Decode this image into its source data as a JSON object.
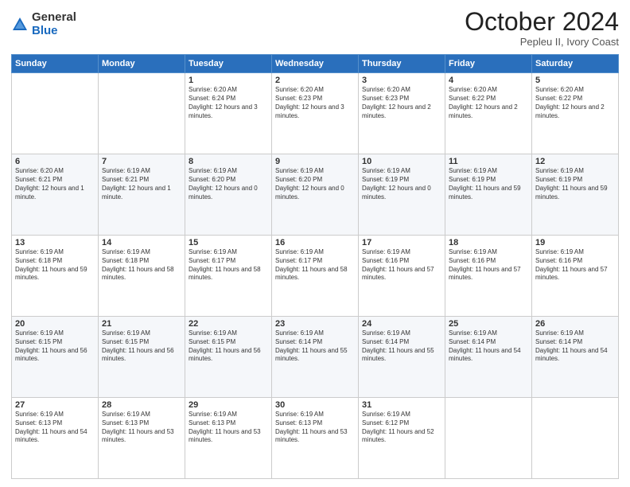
{
  "header": {
    "logo_general": "General",
    "logo_blue": "Blue",
    "month_title": "October 2024",
    "location": "Pepleu II, Ivory Coast"
  },
  "days_of_week": [
    "Sunday",
    "Monday",
    "Tuesday",
    "Wednesday",
    "Thursday",
    "Friday",
    "Saturday"
  ],
  "weeks": [
    [
      {
        "day": "",
        "sunrise": "",
        "sunset": "",
        "daylight": ""
      },
      {
        "day": "",
        "sunrise": "",
        "sunset": "",
        "daylight": ""
      },
      {
        "day": "1",
        "sunrise": "Sunrise: 6:20 AM",
        "sunset": "Sunset: 6:24 PM",
        "daylight": "Daylight: 12 hours and 3 minutes."
      },
      {
        "day": "2",
        "sunrise": "Sunrise: 6:20 AM",
        "sunset": "Sunset: 6:23 PM",
        "daylight": "Daylight: 12 hours and 3 minutes."
      },
      {
        "day": "3",
        "sunrise": "Sunrise: 6:20 AM",
        "sunset": "Sunset: 6:23 PM",
        "daylight": "Daylight: 12 hours and 2 minutes."
      },
      {
        "day": "4",
        "sunrise": "Sunrise: 6:20 AM",
        "sunset": "Sunset: 6:22 PM",
        "daylight": "Daylight: 12 hours and 2 minutes."
      },
      {
        "day": "5",
        "sunrise": "Sunrise: 6:20 AM",
        "sunset": "Sunset: 6:22 PM",
        "daylight": "Daylight: 12 hours and 2 minutes."
      }
    ],
    [
      {
        "day": "6",
        "sunrise": "Sunrise: 6:20 AM",
        "sunset": "Sunset: 6:21 PM",
        "daylight": "Daylight: 12 hours and 1 minute."
      },
      {
        "day": "7",
        "sunrise": "Sunrise: 6:19 AM",
        "sunset": "Sunset: 6:21 PM",
        "daylight": "Daylight: 12 hours and 1 minute."
      },
      {
        "day": "8",
        "sunrise": "Sunrise: 6:19 AM",
        "sunset": "Sunset: 6:20 PM",
        "daylight": "Daylight: 12 hours and 0 minutes."
      },
      {
        "day": "9",
        "sunrise": "Sunrise: 6:19 AM",
        "sunset": "Sunset: 6:20 PM",
        "daylight": "Daylight: 12 hours and 0 minutes."
      },
      {
        "day": "10",
        "sunrise": "Sunrise: 6:19 AM",
        "sunset": "Sunset: 6:19 PM",
        "daylight": "Daylight: 12 hours and 0 minutes."
      },
      {
        "day": "11",
        "sunrise": "Sunrise: 6:19 AM",
        "sunset": "Sunset: 6:19 PM",
        "daylight": "Daylight: 11 hours and 59 minutes."
      },
      {
        "day": "12",
        "sunrise": "Sunrise: 6:19 AM",
        "sunset": "Sunset: 6:19 PM",
        "daylight": "Daylight: 11 hours and 59 minutes."
      }
    ],
    [
      {
        "day": "13",
        "sunrise": "Sunrise: 6:19 AM",
        "sunset": "Sunset: 6:18 PM",
        "daylight": "Daylight: 11 hours and 59 minutes."
      },
      {
        "day": "14",
        "sunrise": "Sunrise: 6:19 AM",
        "sunset": "Sunset: 6:18 PM",
        "daylight": "Daylight: 11 hours and 58 minutes."
      },
      {
        "day": "15",
        "sunrise": "Sunrise: 6:19 AM",
        "sunset": "Sunset: 6:17 PM",
        "daylight": "Daylight: 11 hours and 58 minutes."
      },
      {
        "day": "16",
        "sunrise": "Sunrise: 6:19 AM",
        "sunset": "Sunset: 6:17 PM",
        "daylight": "Daylight: 11 hours and 58 minutes."
      },
      {
        "day": "17",
        "sunrise": "Sunrise: 6:19 AM",
        "sunset": "Sunset: 6:16 PM",
        "daylight": "Daylight: 11 hours and 57 minutes."
      },
      {
        "day": "18",
        "sunrise": "Sunrise: 6:19 AM",
        "sunset": "Sunset: 6:16 PM",
        "daylight": "Daylight: 11 hours and 57 minutes."
      },
      {
        "day": "19",
        "sunrise": "Sunrise: 6:19 AM",
        "sunset": "Sunset: 6:16 PM",
        "daylight": "Daylight: 11 hours and 57 minutes."
      }
    ],
    [
      {
        "day": "20",
        "sunrise": "Sunrise: 6:19 AM",
        "sunset": "Sunset: 6:15 PM",
        "daylight": "Daylight: 11 hours and 56 minutes."
      },
      {
        "day": "21",
        "sunrise": "Sunrise: 6:19 AM",
        "sunset": "Sunset: 6:15 PM",
        "daylight": "Daylight: 11 hours and 56 minutes."
      },
      {
        "day": "22",
        "sunrise": "Sunrise: 6:19 AM",
        "sunset": "Sunset: 6:15 PM",
        "daylight": "Daylight: 11 hours and 56 minutes."
      },
      {
        "day": "23",
        "sunrise": "Sunrise: 6:19 AM",
        "sunset": "Sunset: 6:14 PM",
        "daylight": "Daylight: 11 hours and 55 minutes."
      },
      {
        "day": "24",
        "sunrise": "Sunrise: 6:19 AM",
        "sunset": "Sunset: 6:14 PM",
        "daylight": "Daylight: 11 hours and 55 minutes."
      },
      {
        "day": "25",
        "sunrise": "Sunrise: 6:19 AM",
        "sunset": "Sunset: 6:14 PM",
        "daylight": "Daylight: 11 hours and 54 minutes."
      },
      {
        "day": "26",
        "sunrise": "Sunrise: 6:19 AM",
        "sunset": "Sunset: 6:14 PM",
        "daylight": "Daylight: 11 hours and 54 minutes."
      }
    ],
    [
      {
        "day": "27",
        "sunrise": "Sunrise: 6:19 AM",
        "sunset": "Sunset: 6:13 PM",
        "daylight": "Daylight: 11 hours and 54 minutes."
      },
      {
        "day": "28",
        "sunrise": "Sunrise: 6:19 AM",
        "sunset": "Sunset: 6:13 PM",
        "daylight": "Daylight: 11 hours and 53 minutes."
      },
      {
        "day": "29",
        "sunrise": "Sunrise: 6:19 AM",
        "sunset": "Sunset: 6:13 PM",
        "daylight": "Daylight: 11 hours and 53 minutes."
      },
      {
        "day": "30",
        "sunrise": "Sunrise: 6:19 AM",
        "sunset": "Sunset: 6:13 PM",
        "daylight": "Daylight: 11 hours and 53 minutes."
      },
      {
        "day": "31",
        "sunrise": "Sunrise: 6:19 AM",
        "sunset": "Sunset: 6:12 PM",
        "daylight": "Daylight: 11 hours and 52 minutes."
      },
      {
        "day": "",
        "sunrise": "",
        "sunset": "",
        "daylight": ""
      },
      {
        "day": "",
        "sunrise": "",
        "sunset": "",
        "daylight": ""
      }
    ]
  ]
}
